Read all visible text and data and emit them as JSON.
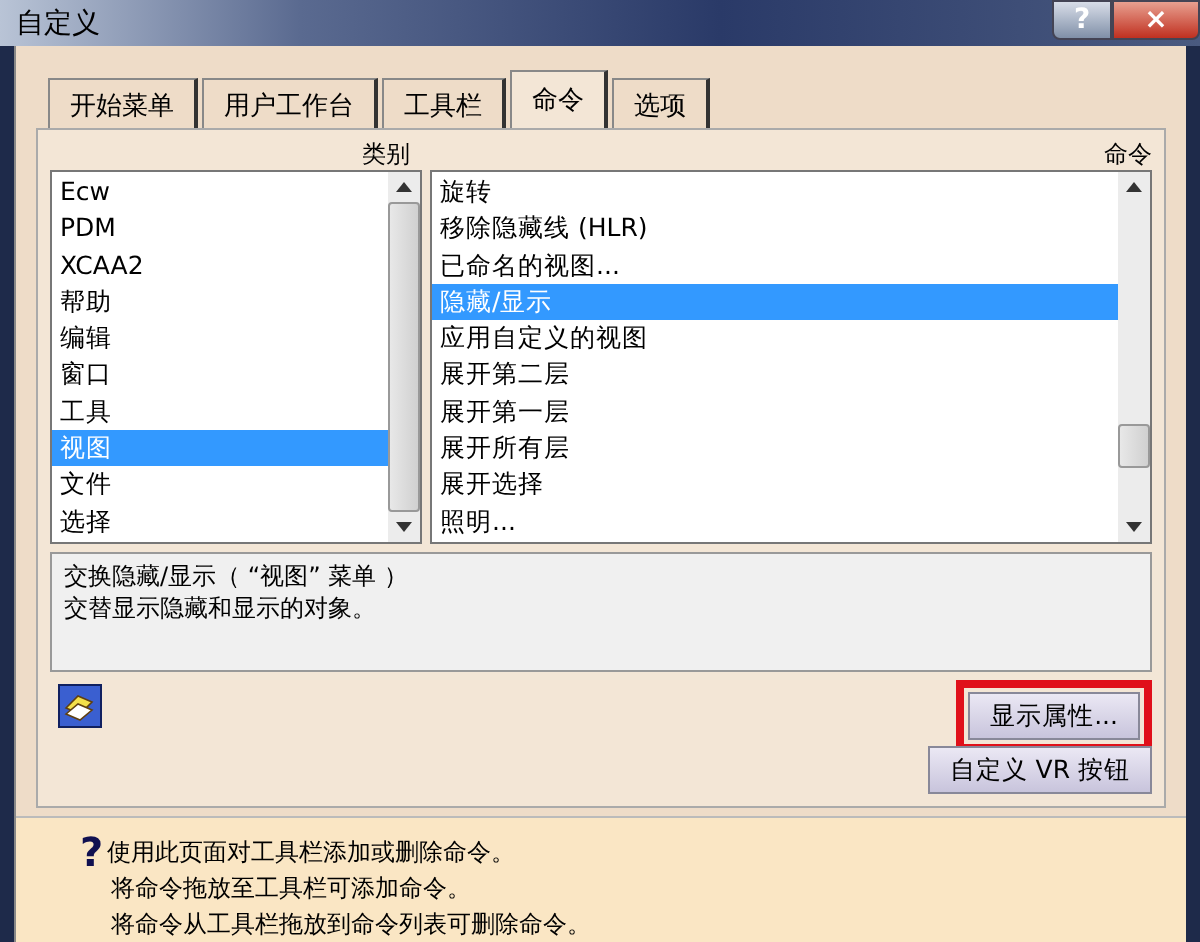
{
  "window": {
    "title": "自定义",
    "controls": [
      "?",
      "×"
    ]
  },
  "tabs": [
    {
      "label": "开始菜单",
      "selected": false
    },
    {
      "label": "用户工作台",
      "selected": false
    },
    {
      "label": "工具栏",
      "selected": false
    },
    {
      "label": "命令",
      "selected": true
    },
    {
      "label": "选项",
      "selected": false
    }
  ],
  "categories": {
    "heading": "类别",
    "items": [
      {
        "label": "Ecw",
        "selected": false
      },
      {
        "label": "PDM",
        "selected": false
      },
      {
        "label": "XCAA2",
        "selected": false
      },
      {
        "label": "帮助",
        "selected": false
      },
      {
        "label": "编辑",
        "selected": false
      },
      {
        "label": "窗口",
        "selected": false
      },
      {
        "label": "工具",
        "selected": false
      },
      {
        "label": "视图",
        "selected": true
      },
      {
        "label": "文件",
        "selected": false
      },
      {
        "label": "选择",
        "selected": false
      }
    ]
  },
  "commands": {
    "heading": "命令",
    "items": [
      {
        "label": "旋转",
        "selected": false
      },
      {
        "label": "移除隐藏线 (HLR)",
        "selected": false
      },
      {
        "label": "已命名的视图...",
        "selected": false
      },
      {
        "label": "隐藏/显示",
        "selected": true
      },
      {
        "label": "应用自定义的视图",
        "selected": false
      },
      {
        "label": "展开第二层",
        "selected": false
      },
      {
        "label": "展开第一层",
        "selected": false
      },
      {
        "label": "展开所有层",
        "selected": false
      },
      {
        "label": "展开选择",
        "selected": false
      },
      {
        "label": "照明...",
        "selected": false
      }
    ]
  },
  "description": [
    "交换隐藏/显示（ “视图” 菜单 ）",
    "交替显示隐藏和显示的对象。"
  ],
  "buttons": [
    {
      "label": "显示属性...",
      "highlighted": true
    },
    {
      "label": "自定义 VR 按钮",
      "highlighted": false
    }
  ],
  "help": {
    "icon": "?",
    "lines": [
      "使用此页面对工具栏添加或删除命令。",
      "将命令拖放至工具栏可添加命令。",
      "将命令从工具栏拖放到命令列表可删除命令。"
    ]
  }
}
